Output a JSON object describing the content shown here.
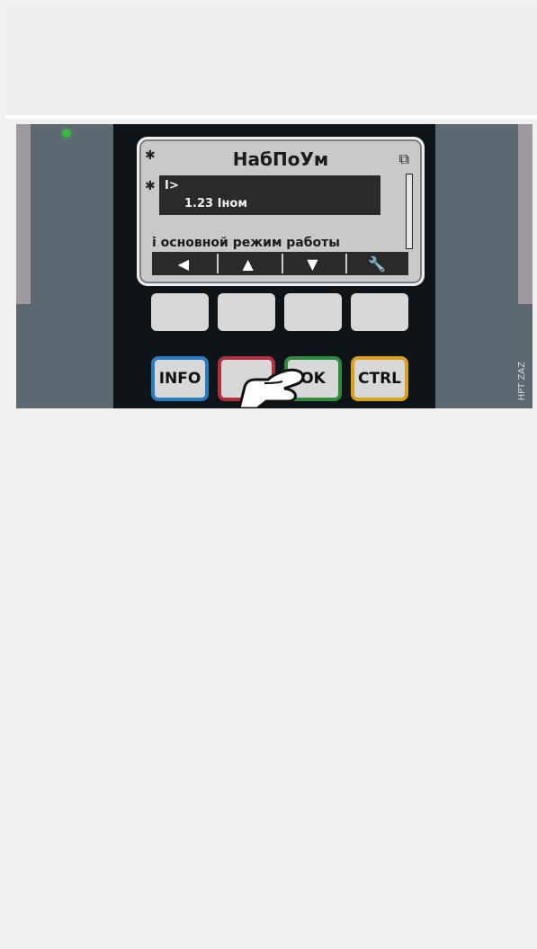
{
  "lcd": {
    "header_title": "НабПоУм",
    "item_name": "I>",
    "item_value": "1.23 Iном",
    "mode_line": "i основной режим работы",
    "softkeys": [
      "◀",
      "▲",
      "▼",
      "🔧"
    ]
  },
  "keys": [
    {
      "label": "INFO",
      "color": "#2a7bc0"
    },
    {
      "label": "",
      "color": "#b03040"
    },
    {
      "label": "OK",
      "color": "#2f8a3d"
    },
    {
      "label": "CTRL",
      "color": "#d9a21e"
    }
  ],
  "watermark": "HPT ZAZ"
}
